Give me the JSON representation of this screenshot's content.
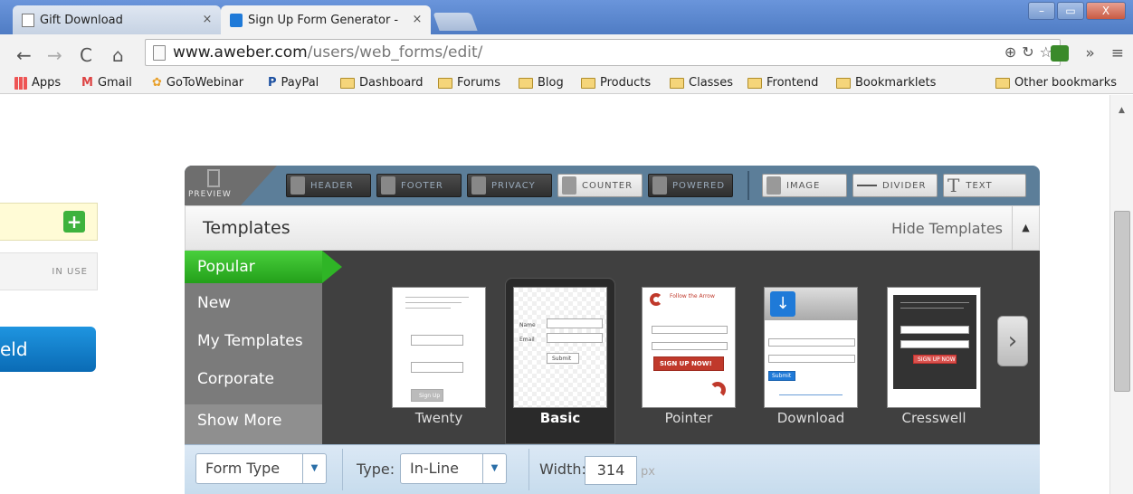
{
  "browser": {
    "tabs": [
      {
        "title": "Gift Download",
        "close": "×"
      },
      {
        "title": "Sign Up Form Generator -",
        "close": "×"
      }
    ],
    "window_buttons": [
      "–",
      "▭",
      "X"
    ],
    "url_host": "www.aweber.com",
    "url_path": "/users/web_forms/edit/",
    "bookmarks": [
      "Apps",
      "Gmail",
      "GoToWebinar",
      "PayPal",
      "Dashboard",
      "Forums",
      "Blog",
      "Products",
      "Classes",
      "Frontend",
      "Bookmarklets"
    ],
    "other_bookmarks": "Other bookmarks"
  },
  "left": {
    "in_use": "IN USE",
    "field_fragment": "eld"
  },
  "toolbar": {
    "preview": "PREVIEW",
    "buttons": [
      "HEADER",
      "FOOTER",
      "PRIVACY",
      "COUNTER",
      "POWERED"
    ],
    "right_buttons": [
      "IMAGE",
      "DIVIDER",
      "TEXT"
    ]
  },
  "templates": {
    "title": "Templates",
    "hide_label": "Hide Templates",
    "categories": [
      "Popular",
      "New",
      "My Templates",
      "Corporate"
    ],
    "show_more": "Show More",
    "items": [
      "Twenty",
      "Basic",
      "Pointer",
      "Download",
      "Cresswell"
    ],
    "selected": "Basic",
    "thumb_text": {
      "basic_name": "Name",
      "basic_email": "Email",
      "basic_submit": "Submit",
      "pointer_heading": "Follow the Arrow",
      "pointer_button": "SIGN UP NOW!",
      "download_button": "Submit",
      "cresswell_button": "SIGN UP NOW",
      "twenty_button": "Sign Up"
    }
  },
  "bottom": {
    "form_type": "Form Type",
    "type_label": "Type:",
    "type_value": "In-Line",
    "width_label": "Width:",
    "width_value": "314",
    "width_unit": "px"
  },
  "colors": {
    "accent_green": "#2fb526",
    "toolbar_blue": "#5c7e99",
    "field_blue": "#0a6bb5"
  }
}
